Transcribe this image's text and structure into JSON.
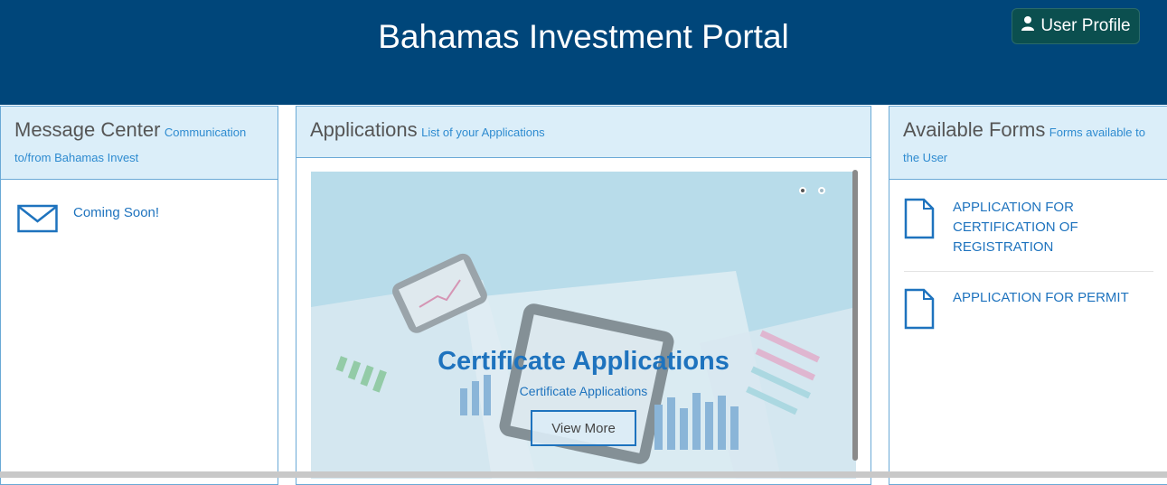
{
  "header": {
    "title": "Bahamas Investment Portal",
    "profile_label": "User Profile"
  },
  "message_center": {
    "title": "Message Center",
    "subtitle": "Communication to/from Bahamas Invest",
    "items": [
      {
        "icon": "envelope-icon",
        "text": "Coming Soon!"
      }
    ]
  },
  "applications": {
    "title": "Applications",
    "subtitle": "List of your Applications",
    "carousel": {
      "slide_title": "Certificate Applications",
      "slide_subtitle": "Certificate Applications",
      "button_label": "View More",
      "slide_count": 2,
      "active_slide": 1
    }
  },
  "available_forms": {
    "title": "Available Forms",
    "subtitle": "Forms available to the User",
    "items": [
      {
        "icon": "document-icon",
        "label": "APPLICATION FOR CERTIFICATION OF REGISTRATION"
      },
      {
        "icon": "document-icon",
        "label": "APPLICATION FOR PERMIT"
      }
    ]
  },
  "colors": {
    "header_bg": "#00467a",
    "accent": "#1e73be",
    "panel_head_bg": "#dbeef9"
  }
}
